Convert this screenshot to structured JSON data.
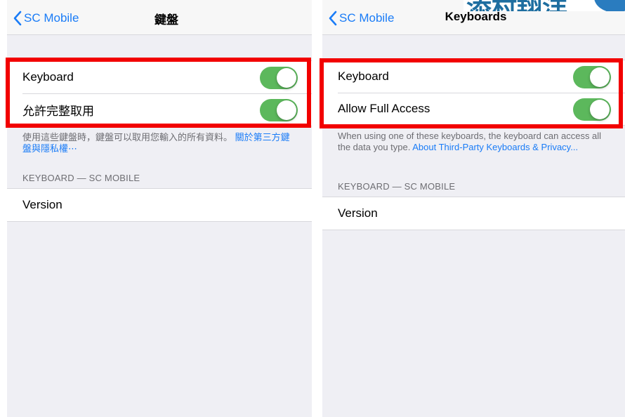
{
  "colors": {
    "accent": "#1a7cf7",
    "toggle_on": "#5cb85c",
    "highlight": "#f20000",
    "background": "#efeff4"
  },
  "left": {
    "nav": {
      "back_label": "SC Mobile",
      "title": "鍵盤"
    },
    "rows": [
      {
        "label": "Keyboard",
        "toggle": "on"
      },
      {
        "label": "允許完整取用",
        "toggle": "on"
      }
    ],
    "footnote": {
      "text": "使用這些鍵盤時，鍵盤可以取用您輸入的所有資料。",
      "link": "關於第三方鍵盤與隱私權⋯"
    },
    "section_header": "KEYBOARD — SC MOBILE",
    "version_label": "Version"
  },
  "right": {
    "nav": {
      "back_label": "SC Mobile",
      "title": "Keyboards"
    },
    "rows": [
      {
        "label": "Keyboard",
        "toggle": "on"
      },
      {
        "label": "Allow Full Access",
        "toggle": "on"
      }
    ],
    "footnote": {
      "text": "When using one of these keyboards, the keyboard can access all the data you type.",
      "link": "About Third-Party Keyboards & Privacy..."
    },
    "section_header": "KEYBOARD — SC MOBILE",
    "version_label": "Version"
  },
  "watermark": {
    "text": "添村翔洋"
  }
}
